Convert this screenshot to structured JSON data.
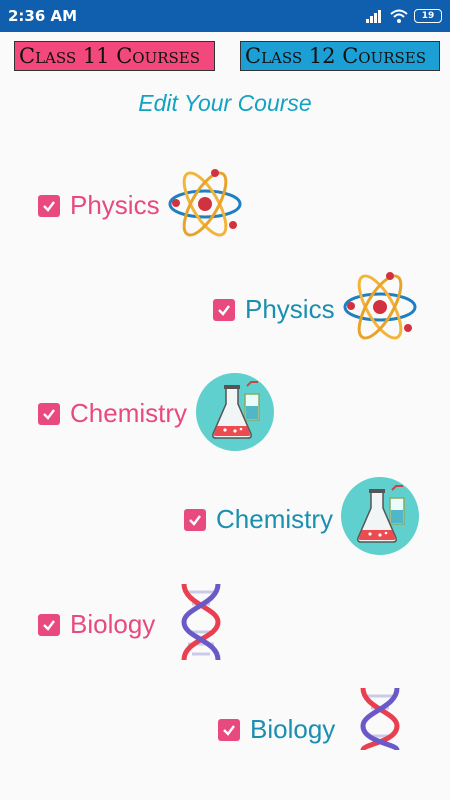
{
  "status_bar": {
    "time": "2:36 AM",
    "battery": "19"
  },
  "header": {
    "class11_label": "Class 11 Courses",
    "class12_label": "Class 12 Courses"
  },
  "page_title": "Edit Your Course",
  "courses": [
    {
      "label": "Physics",
      "checked": true,
      "color": "#e84a7f",
      "icon": "atom-icon"
    },
    {
      "label": "Physics",
      "checked": true,
      "color": "#1a8fb0",
      "icon": "atom-icon"
    },
    {
      "label": "Chemistry",
      "checked": true,
      "color": "#e84a7f",
      "icon": "flask-icon"
    },
    {
      "label": "Chemistry",
      "checked": true,
      "color": "#1a8fb0",
      "icon": "flask-icon"
    },
    {
      "label": "Biology",
      "checked": true,
      "color": "#e84a7f",
      "icon": "dna-icon"
    },
    {
      "label": "Biology",
      "checked": true,
      "color": "#1a8fb0",
      "icon": "dna-icon"
    }
  ],
  "colors": {
    "status_bar": "#0f5fae",
    "class11_bg": "#f2487c",
    "class12_bg": "#1b9fd4",
    "checkbox": "#e84a7f",
    "title": "#12a3c2"
  }
}
